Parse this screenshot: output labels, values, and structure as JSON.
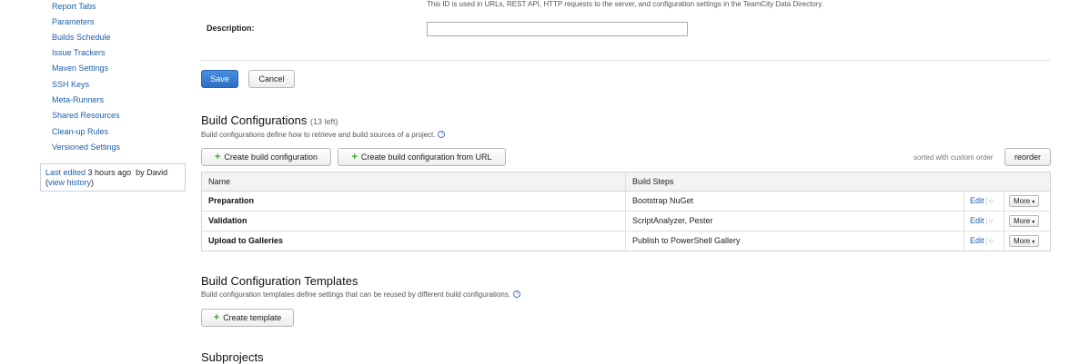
{
  "sidebar": {
    "items": [
      {
        "label": "Report Tabs"
      },
      {
        "label": "Parameters"
      },
      {
        "label": "Builds Schedule"
      },
      {
        "label": "Issue Trackers"
      },
      {
        "label": "Maven Settings"
      },
      {
        "label": "SSH Keys"
      },
      {
        "label": "Meta-Runners"
      },
      {
        "label": "Shared Resources"
      },
      {
        "label": "Clean-up Rules"
      },
      {
        "label": "Versioned Settings"
      }
    ],
    "last_edit": {
      "link": "Last edited",
      "time": " 3 hours ago",
      "by": "  by David",
      "open_paren": "(",
      "history_link": "view history",
      "close_paren": ")"
    }
  },
  "form": {
    "id_hint": "This ID is used in URLs, REST API, HTTP requests to the server, and configuration settings in the TeamCity Data Directory.",
    "description_label": "Description:",
    "description_value": "",
    "save_label": "Save",
    "cancel_label": "Cancel"
  },
  "build_configurations": {
    "title": "Build Configurations",
    "count_text": "(13 left)",
    "description": "Build configurations define how to retrieve and build sources of a project.",
    "help_icon": "?",
    "create_label": "Create build configuration",
    "create_url_label": "Create build configuration from URL",
    "sorted_text": "sorted with custom order",
    "reorder_label": "reorder",
    "columns": [
      "Name",
      "Build Steps"
    ],
    "rows": [
      {
        "name": "Preparation",
        "steps": "Bootstrap NuGet",
        "edit": "Edit",
        "more": "More"
      },
      {
        "name": "Validation",
        "steps": "ScriptAnalyzer, Pester",
        "edit": "Edit",
        "more": "More"
      },
      {
        "name": "Upload to Galleries",
        "steps": "Publish to PowerShell Gallery",
        "edit": "Edit",
        "more": "More"
      }
    ]
  },
  "templates": {
    "title": "Build Configuration Templates",
    "description": "Build configuration templates define settings that can be reused by different build configurations.",
    "help_icon": "?",
    "create_label": "Create template"
  },
  "subprojects": {
    "title": "Subprojects"
  },
  "icons": {
    "plus": "+",
    "caret": "▾",
    "edit_sep": "|",
    "edit_caret": "▽"
  },
  "colors": {
    "link": "#1d5faa",
    "primary_button": "#2d6fc4",
    "plus_icon": "#3aa233"
  }
}
